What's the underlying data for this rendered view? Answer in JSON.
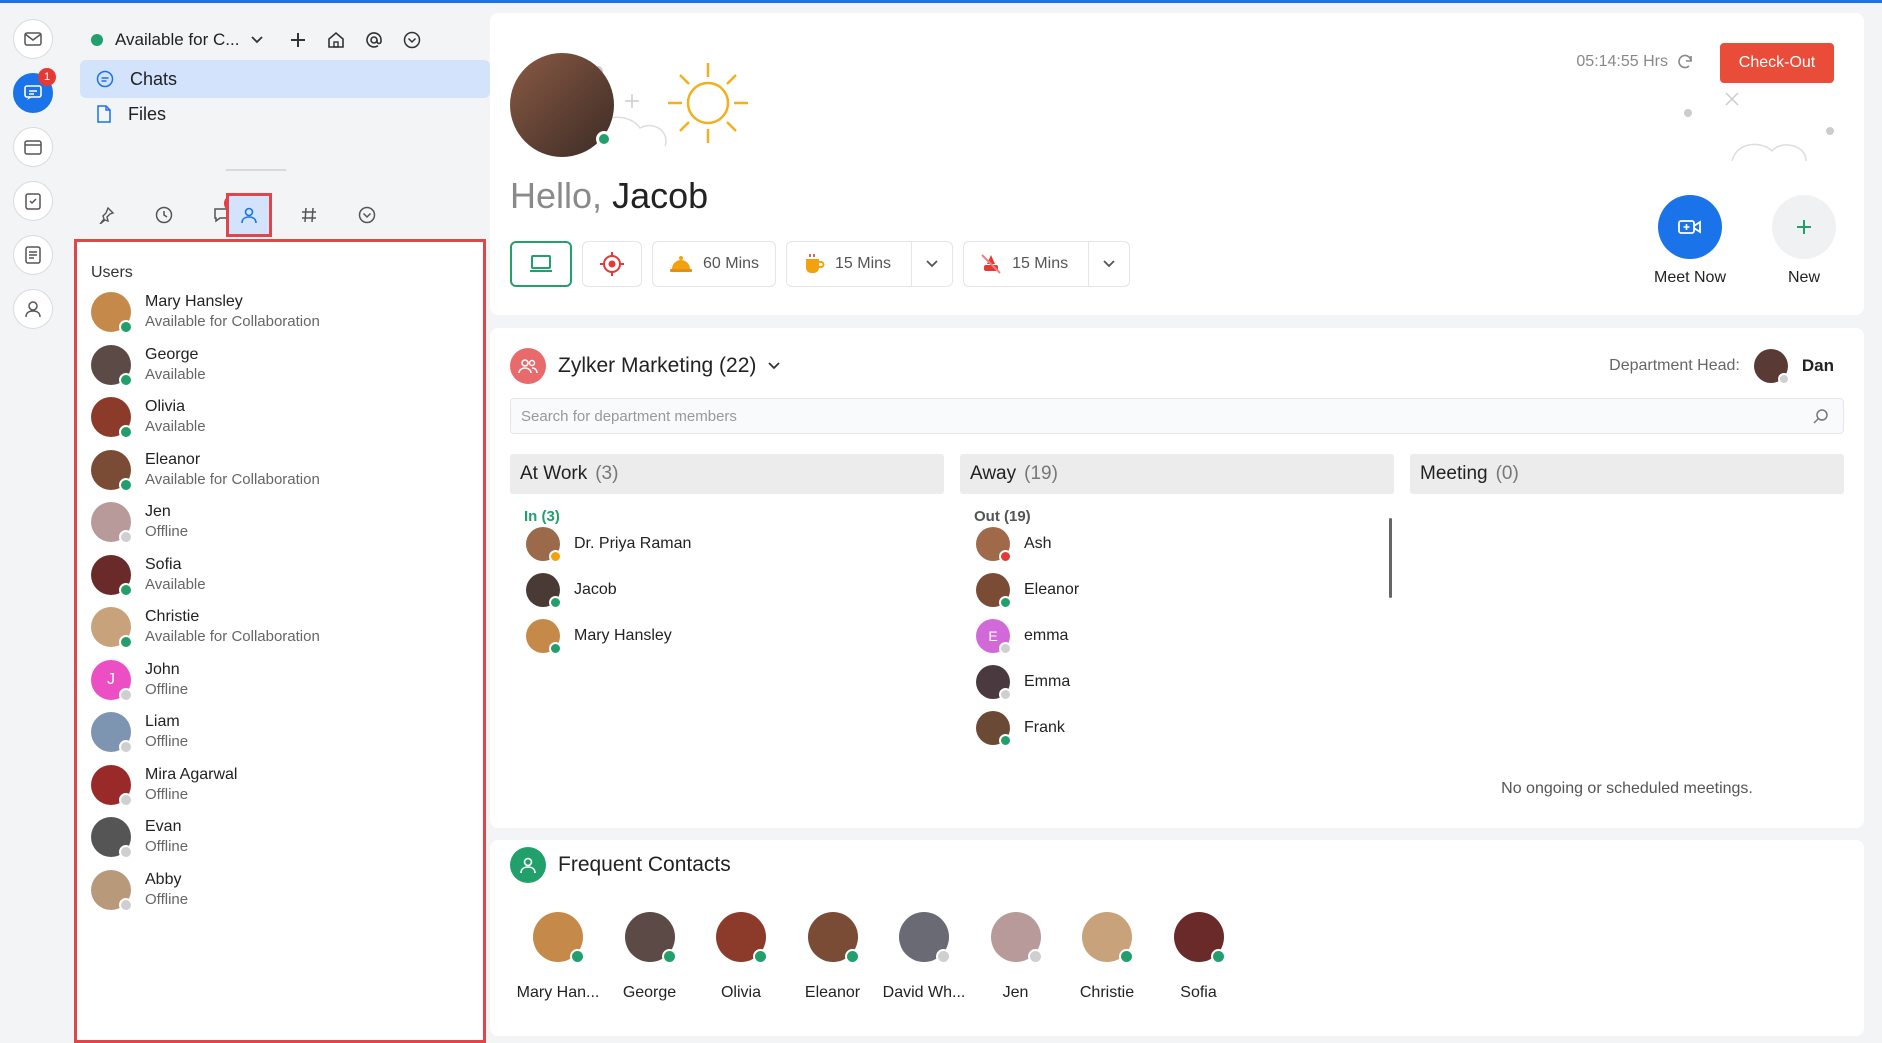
{
  "status": {
    "label": "Available for C...",
    "color": "#22a06b"
  },
  "rail": {
    "badge": "1"
  },
  "nav": {
    "chats": "Chats",
    "files": "Files"
  },
  "tabs": {
    "threads_badge": "1"
  },
  "users": {
    "title": "Users",
    "items": [
      {
        "name": "Mary Hansley",
        "status": "Available for Collaboration",
        "color": "#c58a4a",
        "presence": "#22a06b"
      },
      {
        "name": "George",
        "status": "Available",
        "color": "#5b4a45",
        "presence": "#22a06b"
      },
      {
        "name": "Olivia",
        "status": "Available",
        "color": "#8c3a2a",
        "presence": "#22a06b"
      },
      {
        "name": "Eleanor",
        "status": "Available for Collaboration",
        "color": "#7a4b35",
        "presence": "#22a06b"
      },
      {
        "name": "Jen",
        "status": "Offline",
        "color": "#b99a9a",
        "presence": "#cfcfcf"
      },
      {
        "name": "Sofia",
        "status": "Available",
        "color": "#6a2a2a",
        "presence": "#22a06b"
      },
      {
        "name": "Christie",
        "status": "Available for Collaboration",
        "color": "#c8a27a",
        "presence": "#22a06b"
      },
      {
        "name": "John",
        "status": "Offline",
        "color": "#ec4fc4",
        "presence": "#cfcfcf",
        "initial": "J"
      },
      {
        "name": "Liam",
        "status": "Offline",
        "color": "#7d95b0",
        "presence": "#cfcfcf"
      },
      {
        "name": "Mira Agarwal",
        "status": "Offline",
        "color": "#9a2a2a",
        "presence": "#cfcfcf"
      },
      {
        "name": "Evan",
        "status": "Offline",
        "color": "#555555",
        "presence": "#cfcfcf"
      },
      {
        "name": "Abby",
        "status": "Offline",
        "color": "#b89a7a",
        "presence": "#cfcfcf"
      }
    ]
  },
  "hero": {
    "hello": "Hello,",
    "name": "Jacob",
    "timer": "05:14:55 Hrs",
    "checkout": "Check-Out",
    "pill_lunch": "60 Mins",
    "pill_coffee": "15 Mins",
    "pill_break": "15 Mins",
    "meet_now": "Meet Now",
    "new": "New"
  },
  "dept": {
    "title": "Zylker Marketing (22)",
    "head_label": "Department Head:",
    "head_name": "Dan",
    "search_placeholder": "Search for department members",
    "at_work": {
      "label": "At Work",
      "count": "(3)",
      "sub": "In (3)"
    },
    "away": {
      "label": "Away",
      "count": "(19)",
      "sub": "Out (19)"
    },
    "meeting": {
      "label": "Meeting",
      "count": "(0)",
      "empty": "No ongoing or scheduled meetings."
    },
    "in_members": [
      {
        "name": "Dr. Priya Raman",
        "color": "#9a6a4a",
        "presence": "#f2a20c"
      },
      {
        "name": "Jacob",
        "color": "#4a3a35",
        "presence": "#22a06b"
      },
      {
        "name": "Mary Hansley",
        "color": "#c58a4a",
        "presence": "#22a06b"
      }
    ],
    "out_members": [
      {
        "name": "Ash",
        "color": "#a06a4a",
        "presence": "#e53935"
      },
      {
        "name": "Eleanor",
        "color": "#7a4b35",
        "presence": "#22a06b"
      },
      {
        "name": "emma",
        "color": "#d16ad8",
        "presence": "#cfcfcf",
        "initial": "E"
      },
      {
        "name": "Emma",
        "color": "#4a3a40",
        "presence": "#cfcfcf"
      },
      {
        "name": "Frank",
        "color": "#6a4a35",
        "presence": "#22a06b"
      }
    ]
  },
  "frequent": {
    "title": "Frequent Contacts",
    "items": [
      {
        "name": "Mary Han...",
        "color": "#c58a4a",
        "presence": "#22a06b"
      },
      {
        "name": "George",
        "color": "#5b4a45",
        "presence": "#22a06b"
      },
      {
        "name": "Olivia",
        "color": "#8c3a2a",
        "presence": "#22a06b"
      },
      {
        "name": "Eleanor",
        "color": "#7a4b35",
        "presence": "#22a06b"
      },
      {
        "name": "David Wh...",
        "color": "#6a6a75",
        "presence": "#cfcfcf"
      },
      {
        "name": "Jen",
        "color": "#b99a9a",
        "presence": "#cfcfcf"
      },
      {
        "name": "Christie",
        "color": "#c8a27a",
        "presence": "#22a06b"
      },
      {
        "name": "Sofia",
        "color": "#6a2a2a",
        "presence": "#22a06b"
      }
    ]
  }
}
